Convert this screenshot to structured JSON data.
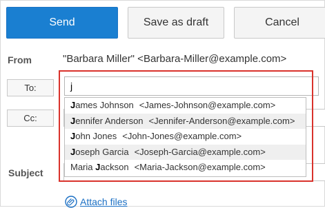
{
  "toolbar": {
    "send_label": "Send",
    "draft_label": "Save as draft",
    "cancel_label": "Cancel"
  },
  "from": {
    "label": "From",
    "value": "\"Barbara Miller\" <Barbara-Miller@example.com>"
  },
  "to": {
    "button_label": "To:",
    "input_value": "j"
  },
  "cc": {
    "button_label": "Cc:"
  },
  "subject": {
    "label": "Subject"
  },
  "suggestions": [
    {
      "first": "J",
      "rest": "ames Johnson",
      "email": "<James-Johnson@example.com>"
    },
    {
      "first": "J",
      "rest": "ennifer Anderson",
      "email": "<Jennifer-Anderson@example.com>"
    },
    {
      "first": "J",
      "rest": "ohn Jones",
      "email": "<John-Jones@example.com>"
    },
    {
      "first": "J",
      "rest": "oseph Garcia",
      "email": "<Joseph-Garcia@example.com>"
    },
    {
      "first": "Maria ",
      "bold": "J",
      "rest": "ackson",
      "email": "<Maria-Jackson@example.com>"
    }
  ],
  "attach": {
    "label": "Attach files",
    "icon": "paperclip-icon"
  },
  "colors": {
    "accent": "#1a7fd1",
    "highlight_border": "#d9322b"
  }
}
